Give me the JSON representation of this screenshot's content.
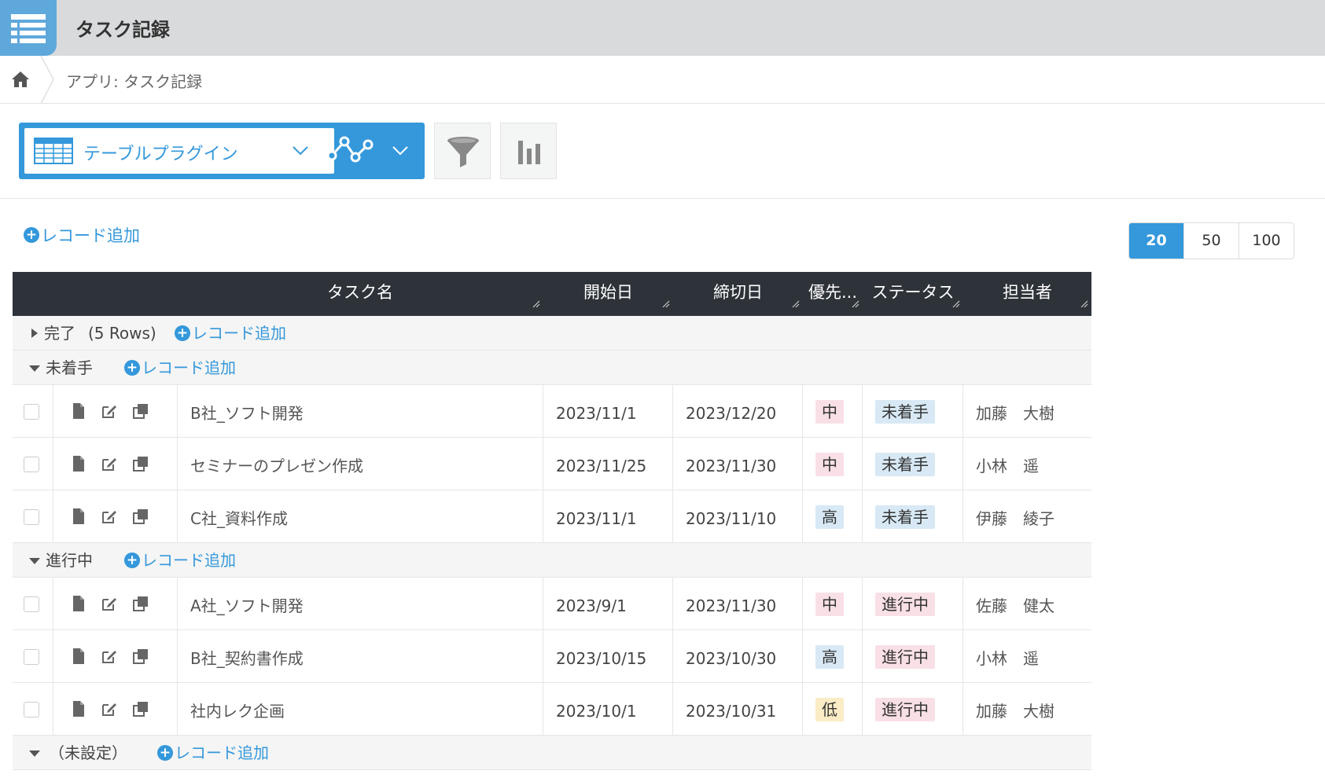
{
  "header": {
    "title": "タスク記録",
    "app_icon": "list-icon"
  },
  "breadcrumb": {
    "home_icon": "home-icon",
    "path": "アプリ: タスク記録"
  },
  "toolbar": {
    "view_name": "テーブルプラグイン",
    "graph_icon": "graph-icon",
    "filter_icon": "filter-icon",
    "chart_icon": "bar-chart-icon"
  },
  "add_record_label": "レコード追加",
  "pager": {
    "options": [
      "20",
      "50",
      "100"
    ],
    "selected": "20"
  },
  "columns": {
    "task": "タスク名",
    "start": "開始日",
    "due": "締切日",
    "priority": "優先...",
    "status": "ステータス",
    "owner": "担当者"
  },
  "groups": [
    {
      "label": "完了",
      "count": "(5 Rows)",
      "collapsed": true,
      "add": "レコード追加",
      "rows": []
    },
    {
      "label": "未着手",
      "count": "",
      "collapsed": false,
      "add": "レコード追加",
      "rows": [
        {
          "task": "B社_ソフト開発",
          "start": "2023/11/1",
          "due": "2023/12/20",
          "priority": "中",
          "status": "未着手",
          "owner": "加藤　大樹"
        },
        {
          "task": "セミナーのプレゼン作成",
          "start": "2023/11/25",
          "due": "2023/11/30",
          "priority": "中",
          "status": "未着手",
          "owner": "小林　遥"
        },
        {
          "task": "C社_資料作成",
          "start": "2023/11/1",
          "due": "2023/11/10",
          "priority": "高",
          "status": "未着手",
          "owner": "伊藤　綾子"
        }
      ]
    },
    {
      "label": "進行中",
      "count": "",
      "collapsed": false,
      "add": "レコード追加",
      "rows": [
        {
          "task": "A社_ソフト開発",
          "start": "2023/9/1",
          "due": "2023/11/30",
          "priority": "中",
          "status": "進行中",
          "owner": "佐藤　健太"
        },
        {
          "task": "B社_契約書作成",
          "start": "2023/10/15",
          "due": "2023/10/30",
          "priority": "高",
          "status": "進行中",
          "owner": "小林　遥"
        },
        {
          "task": "社内レク企画",
          "start": "2023/10/1",
          "due": "2023/10/31",
          "priority": "低",
          "status": "進行中",
          "owner": "加藤　大樹"
        }
      ]
    },
    {
      "label": "（未設定）",
      "count": "",
      "collapsed": false,
      "add": "レコード追加",
      "rows": []
    }
  ],
  "colors": {
    "accent": "#3498db",
    "header_dark": "#2d3339",
    "badge_mid": "#f9e0e6",
    "badge_high": "#d8e9f5",
    "badge_low": "#fbecc6"
  }
}
